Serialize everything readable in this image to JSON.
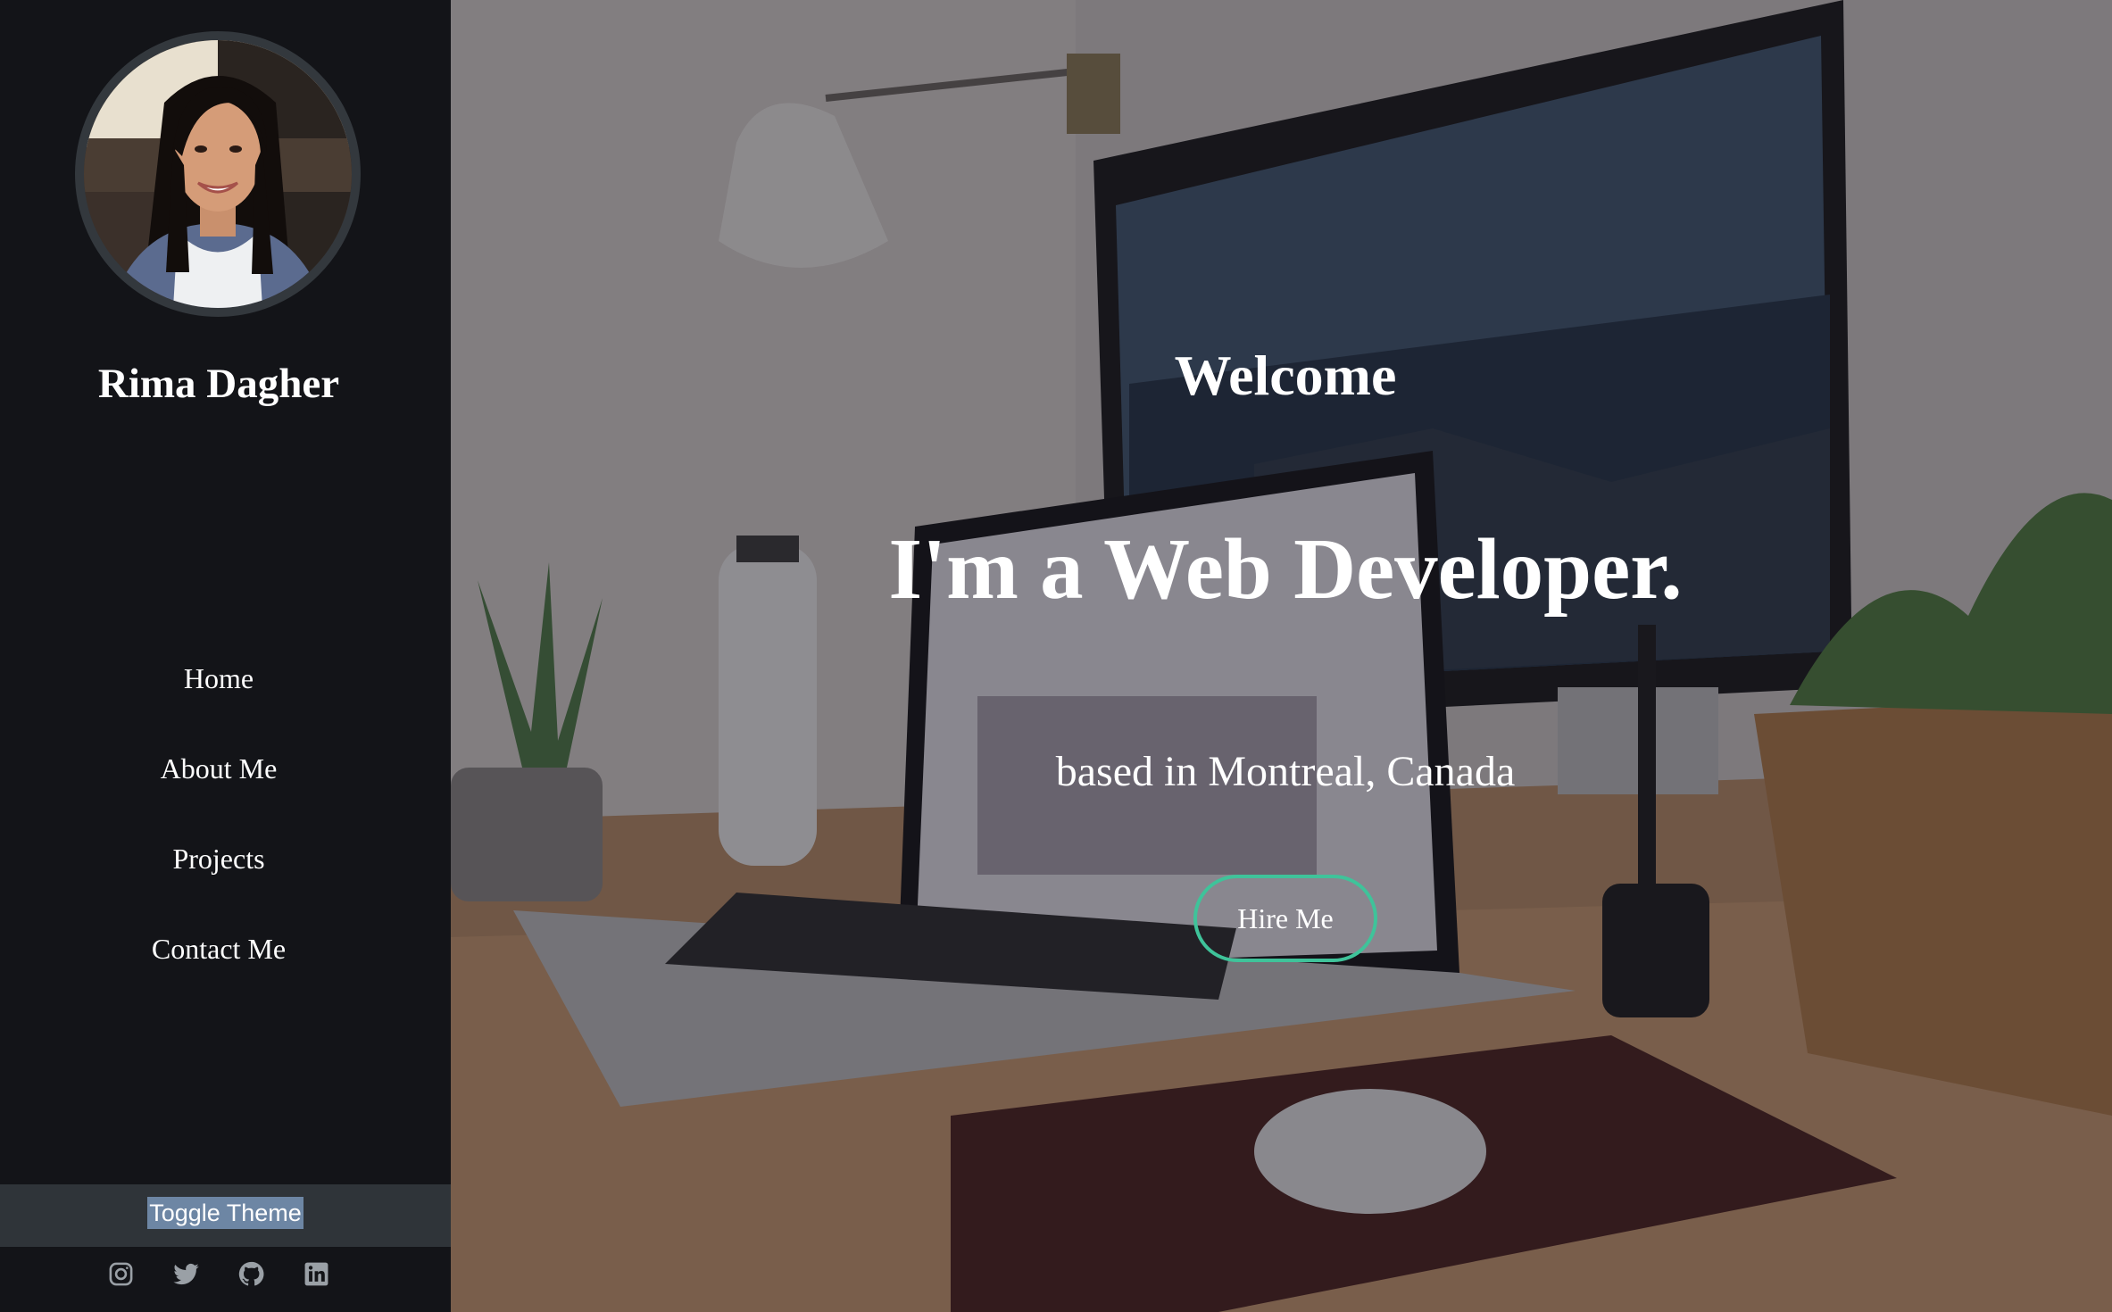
{
  "sidebar": {
    "name": "Rima Dagher",
    "nav": [
      {
        "label": "Home"
      },
      {
        "label": "About Me"
      },
      {
        "label": "Projects"
      },
      {
        "label": "Contact Me"
      }
    ],
    "toggle_label": "Toggle Theme",
    "socials": [
      {
        "icon": "instagram-icon"
      },
      {
        "icon": "twitter-icon"
      },
      {
        "icon": "github-icon"
      },
      {
        "icon": "linkedin-icon"
      }
    ]
  },
  "hero": {
    "welcome": "Welcome",
    "headline": "I'm a Web Developer.",
    "location": "based in Montreal, Canada",
    "cta_label": "Hire Me"
  },
  "colors": {
    "sidebar_bg": "#131418",
    "toggle_bar_bg": "#2f3439",
    "selection_highlight": "#6d86a4",
    "accent": "#3fc39a",
    "text": "#ffffff"
  }
}
